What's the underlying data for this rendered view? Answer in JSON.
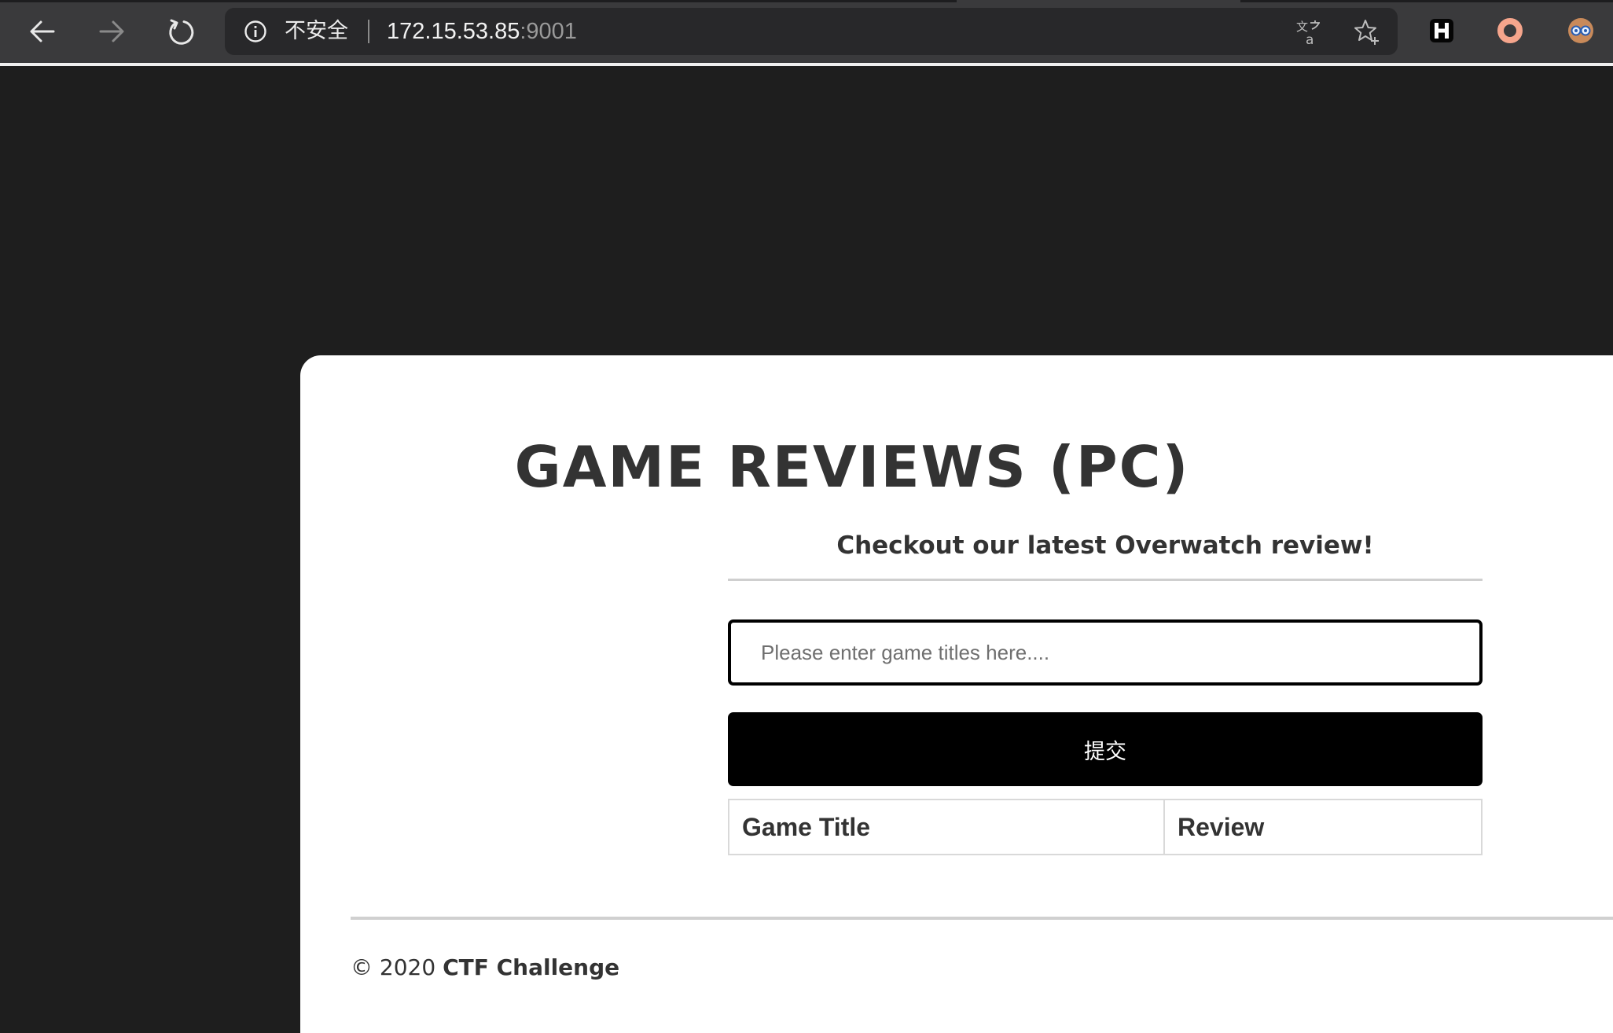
{
  "browser": {
    "security_label": "不安全",
    "url_host": "172.15.53.85",
    "url_port": ":9001",
    "icons": {
      "back": "back-arrow-icon",
      "forward": "forward-arrow-icon",
      "reload": "reload-icon",
      "info": "info-icon",
      "translate": "translate-icon",
      "bookmark": "bookmark-star-icon",
      "extensions": [
        "h-extension-icon",
        "orange-ring-extension-icon",
        "avatar-extension-icon"
      ]
    }
  },
  "page": {
    "title": "GAME REVIEWS (PC)",
    "subtitle": "Checkout our latest Overwatch review!",
    "search": {
      "placeholder": "Please enter game titles here....",
      "value": ""
    },
    "submit_label": "提交",
    "table": {
      "headers": [
        "Game Title",
        "Review"
      ],
      "rows": []
    },
    "footer": {
      "copyright": "© 2020",
      "owner": "CTF Challenge"
    }
  },
  "colors": {
    "page_background": "#1e1e1e",
    "card_background": "#ffffff",
    "text": "#333333",
    "button": "#000000"
  }
}
